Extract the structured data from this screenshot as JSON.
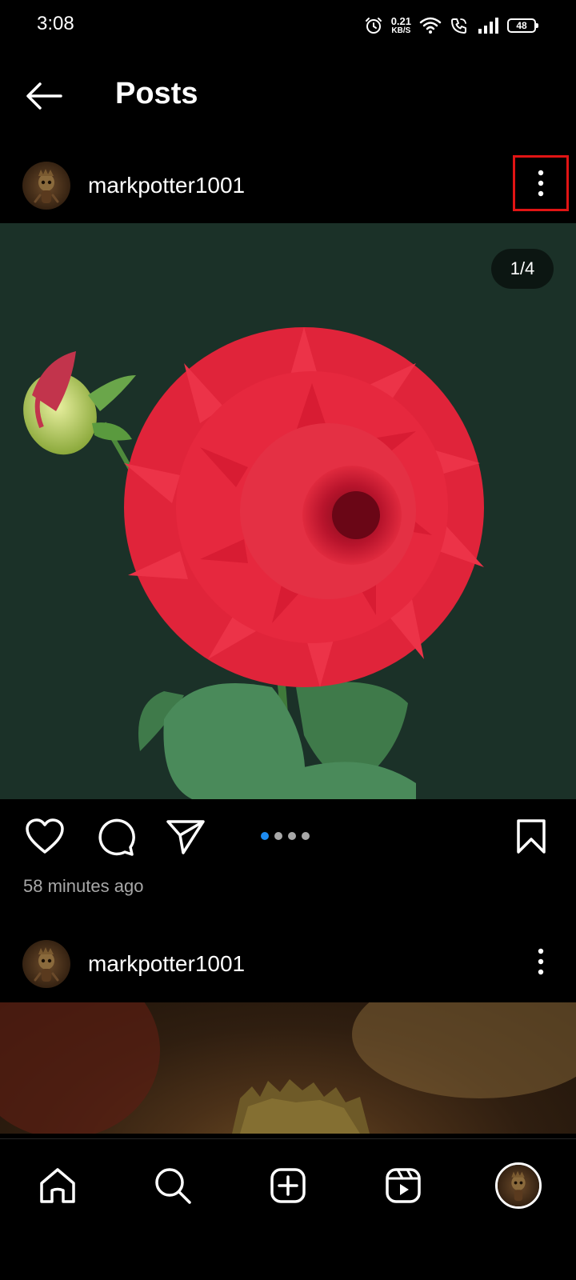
{
  "status_bar": {
    "time": "3:08",
    "net_speed_value": "0.21",
    "net_speed_unit": "KB/S",
    "battery": "48"
  },
  "header": {
    "title": "Posts",
    "back_icon": "arrow-left-icon"
  },
  "posts": [
    {
      "username": "markpotter1001",
      "media_counter": "1/4",
      "carousel": {
        "total": 4,
        "active_index": 0
      },
      "timestamp": "58 minutes ago",
      "more_options_highlighted": true
    },
    {
      "username": "markpotter1001"
    }
  ],
  "actions": [
    "heart-icon",
    "comment-icon",
    "share-icon",
    "bookmark-icon"
  ],
  "bottom_nav": [
    "home-icon",
    "search-icon",
    "create-icon",
    "reels-icon",
    "profile-avatar"
  ],
  "colors": {
    "background": "#000000",
    "accent": "#1d8bf1",
    "highlight_box": "#e11414",
    "secondary_text": "#a8a8a8",
    "media_background": "#1b3128"
  }
}
